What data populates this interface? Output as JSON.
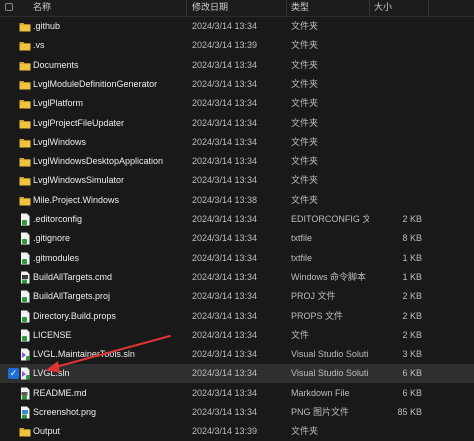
{
  "columns": {
    "name": "名称",
    "date": "修改日期",
    "type": "类型",
    "size": "大小"
  },
  "colors": {
    "folder": "#e8b932",
    "accent": "#1f6fd6",
    "annotation_arrow": "#e03434"
  },
  "rows": [
    {
      "name": ".github",
      "date": "2024/3/14 13:34",
      "type": "文件夹",
      "size": "",
      "icon": "folder-icon",
      "selected": false
    },
    {
      "name": ".vs",
      "date": "2024/3/14 13:39",
      "type": "文件夹",
      "size": "",
      "icon": "folder-icon",
      "selected": false
    },
    {
      "name": "Documents",
      "date": "2024/3/14 13:34",
      "type": "文件夹",
      "size": "",
      "icon": "folder-icon",
      "selected": false
    },
    {
      "name": "LvglModuleDefinitionGenerator",
      "date": "2024/3/14 13:34",
      "type": "文件夹",
      "size": "",
      "icon": "folder-icon",
      "selected": false
    },
    {
      "name": "LvglPlatform",
      "date": "2024/3/14 13:34",
      "type": "文件夹",
      "size": "",
      "icon": "folder-icon",
      "selected": false
    },
    {
      "name": "LvglProjectFileUpdater",
      "date": "2024/3/14 13:34",
      "type": "文件夹",
      "size": "",
      "icon": "folder-icon",
      "selected": false
    },
    {
      "name": "LvglWindows",
      "date": "2024/3/14 13:34",
      "type": "文件夹",
      "size": "",
      "icon": "folder-icon",
      "selected": false
    },
    {
      "name": "LvglWindowsDesktopApplication",
      "date": "2024/3/14 13:34",
      "type": "文件夹",
      "size": "",
      "icon": "folder-icon",
      "selected": false
    },
    {
      "name": "LvglWindowsSimulator",
      "date": "2024/3/14 13:34",
      "type": "文件夹",
      "size": "",
      "icon": "folder-icon",
      "selected": false
    },
    {
      "name": "Mile.Project.Windows",
      "date": "2024/3/14 13:38",
      "type": "文件夹",
      "size": "",
      "icon": "folder-icon",
      "selected": false
    },
    {
      "name": ".editorconfig",
      "date": "2024/3/14 13:34",
      "type": "EDITORCONFIG 文件",
      "size": "2 KB",
      "icon": "file-icon",
      "selected": false
    },
    {
      "name": ".gitignore",
      "date": "2024/3/14 13:34",
      "type": "txtfile",
      "size": "8 KB",
      "icon": "file-icon",
      "selected": false
    },
    {
      "name": ".gitmodules",
      "date": "2024/3/14 13:34",
      "type": "txtfile",
      "size": "1 KB",
      "icon": "file-icon",
      "selected": false
    },
    {
      "name": "BuildAllTargets.cmd",
      "date": "2024/3/14 13:34",
      "type": "Windows 命令脚本",
      "size": "1 KB",
      "icon": "script-icon",
      "selected": false
    },
    {
      "name": "BuildAllTargets.proj",
      "date": "2024/3/14 13:34",
      "type": "PROJ 文件",
      "size": "2 KB",
      "icon": "file-icon",
      "selected": false
    },
    {
      "name": "Directory.Build.props",
      "date": "2024/3/14 13:34",
      "type": "PROPS 文件",
      "size": "2 KB",
      "icon": "file-icon",
      "selected": false
    },
    {
      "name": "LICENSE",
      "date": "2024/3/14 13:34",
      "type": "文件",
      "size": "2 KB",
      "icon": "file-icon",
      "selected": false
    },
    {
      "name": "LVGL.MaintainerTools.sln",
      "date": "2024/3/14 13:34",
      "type": "Visual Studio Soluti...",
      "size": "3 KB",
      "icon": "vs-solution-icon",
      "selected": false
    },
    {
      "name": "LVGL.sln",
      "date": "2024/3/14 13:34",
      "type": "Visual Studio Soluti...",
      "size": "6 KB",
      "icon": "vs-solution-icon",
      "selected": true
    },
    {
      "name": "README.md",
      "date": "2024/3/14 13:34",
      "type": "Markdown File",
      "size": "6 KB",
      "icon": "markdown-icon",
      "selected": false
    },
    {
      "name": "Screenshot.png",
      "date": "2024/3/14 13:34",
      "type": "PNG 图片文件",
      "size": "85 KB",
      "icon": "image-icon",
      "selected": false
    },
    {
      "name": "Output",
      "date": "2024/3/14 13:39",
      "type": "文件夹",
      "size": "",
      "icon": "folder-icon",
      "selected": false
    }
  ]
}
